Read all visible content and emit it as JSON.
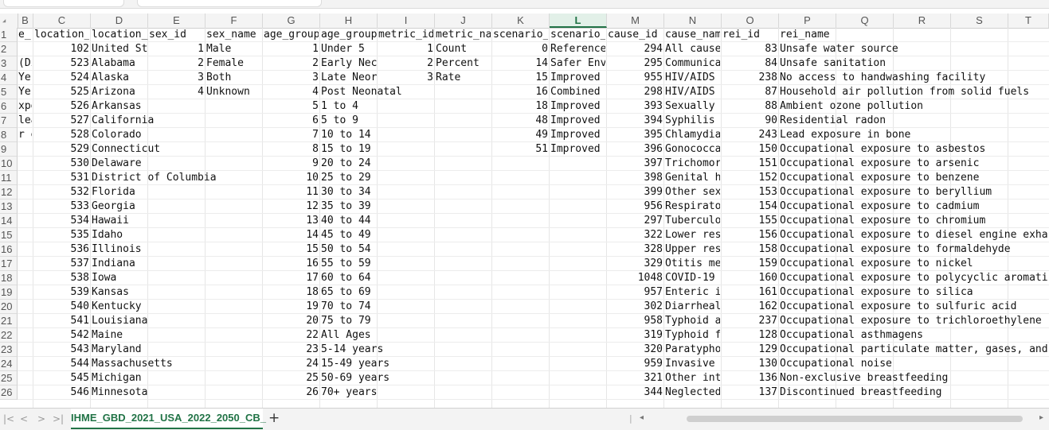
{
  "columns": [
    "B",
    "C",
    "D",
    "E",
    "F",
    "G",
    "H",
    "I",
    "J",
    "K",
    "L",
    "M",
    "N",
    "O",
    "P",
    "Q",
    "R",
    "S",
    "T"
  ],
  "selected_column": "L",
  "rows": [
    {
      "n": "1",
      "B": "e_r",
      "C": "location_",
      "D": "location_",
      "E": "sex_id",
      "F": "sex_name",
      "G": "age_group",
      "H": "age_group",
      "I": "metric_id",
      "J": "metric_na",
      "K": "scenario_",
      "L": "scenario_",
      "M": "cause_id",
      "N": "cause_nam",
      "O": "rei_id",
      "P": "rei_name"
    },
    {
      "n": "2",
      "B": "",
      "C": "102",
      "D": "United St",
      "E": "1",
      "F": "Male",
      "G": "1",
      "H": "Under 5",
      "I": "1",
      "J": "Count",
      "K": "0",
      "L": "Reference",
      "M": "294",
      "N": "All cause",
      "O": "83",
      "P": "Unsafe water source"
    },
    {
      "n": "3",
      "B": "(Di",
      "C": "523",
      "D": "Alabama",
      "E": "2",
      "F": "Female",
      "G": "2",
      "H": "Early Nec",
      "I": "2",
      "J": "Percent",
      "K": "14",
      "L": "Safer Env",
      "M": "295",
      "N": "Communica",
      "O": "84",
      "P": "Unsafe sanitation"
    },
    {
      "n": "4",
      "B": "Yes",
      "C": "524",
      "D": "Alaska",
      "E": "3",
      "F": "Both",
      "G": "3",
      "H": "Late Neor",
      "I": "3",
      "J": "Rate",
      "K": "15",
      "L": "Improved",
      "M": "955",
      "N": "HIV/AIDS",
      "O": "238",
      "P": "No access to handwashing facility"
    },
    {
      "n": "5",
      "B": "Yes",
      "C": "525",
      "D": "Arizona",
      "E": "4",
      "F": "Unknown",
      "G": "4",
      "H": "Post Neonatal",
      "I": "",
      "J": "",
      "K": "16",
      "L": "Combined",
      "M": "298",
      "N": "HIV/AIDS",
      "O": "87",
      "P": "Household air pollution from solid fuels"
    },
    {
      "n": "6",
      "B": "xpe",
      "C": "526",
      "D": "Arkansas",
      "E": "",
      "F": "",
      "G": "5",
      "H": "1 to 4",
      "I": "",
      "J": "",
      "K": "18",
      "L": "Improved",
      "M": "393",
      "N": "Sexually",
      "O": "88",
      "P": "Ambient ozone pollution"
    },
    {
      "n": "7",
      "B": "lea",
      "C": "527",
      "D": "California",
      "E": "",
      "F": "",
      "G": "6",
      "H": "5 to 9",
      "I": "",
      "J": "",
      "K": "48",
      "L": "Improved",
      "M": "394",
      "N": "Syphilis",
      "O": "90",
      "P": "Residential radon"
    },
    {
      "n": "8",
      "B": "r e",
      "C": "528",
      "D": "Colorado",
      "E": "",
      "F": "",
      "G": "7",
      "H": "10 to 14",
      "I": "",
      "J": "",
      "K": "49",
      "L": "Improved",
      "M": "395",
      "N": "Chlamydia",
      "O": "243",
      "P": "Lead exposure in bone"
    },
    {
      "n": "9",
      "B": "",
      "C": "529",
      "D": "Connecticut",
      "E": "",
      "F": "",
      "G": "8",
      "H": "15 to 19",
      "I": "",
      "J": "",
      "K": "51",
      "L": "Improved",
      "M": "396",
      "N": "Gonococca",
      "O": "150",
      "P": "Occupational exposure to asbestos"
    },
    {
      "n": "10",
      "B": "",
      "C": "530",
      "D": "Delaware",
      "E": "",
      "F": "",
      "G": "9",
      "H": "20 to 24",
      "I": "",
      "J": "",
      "K": "",
      "L": "",
      "M": "397",
      "N": "Trichomor",
      "O": "151",
      "P": "Occupational exposure to arsenic"
    },
    {
      "n": "11",
      "B": "",
      "C": "531",
      "D": "District of Columbia",
      "E": "",
      "F": "",
      "G": "10",
      "H": "25 to 29",
      "I": "",
      "J": "",
      "K": "",
      "L": "",
      "M": "398",
      "N": "Genital h",
      "O": "152",
      "P": "Occupational exposure to benzene"
    },
    {
      "n": "12",
      "B": "",
      "C": "532",
      "D": "Florida",
      "E": "",
      "F": "",
      "G": "11",
      "H": "30 to 34",
      "I": "",
      "J": "",
      "K": "",
      "L": "",
      "M": "399",
      "N": "Other sex",
      "O": "153",
      "P": "Occupational exposure to beryllium"
    },
    {
      "n": "13",
      "B": "",
      "C": "533",
      "D": "Georgia",
      "E": "",
      "F": "",
      "G": "12",
      "H": "35 to 39",
      "I": "",
      "J": "",
      "K": "",
      "L": "",
      "M": "956",
      "N": "Respirato",
      "O": "154",
      "P": "Occupational exposure to cadmium"
    },
    {
      "n": "14",
      "B": "",
      "C": "534",
      "D": "Hawaii",
      "E": "",
      "F": "",
      "G": "13",
      "H": "40 to 44",
      "I": "",
      "J": "",
      "K": "",
      "L": "",
      "M": "297",
      "N": "Tuberculo",
      "O": "155",
      "P": "Occupational exposure to chromium"
    },
    {
      "n": "15",
      "B": "",
      "C": "535",
      "D": "Idaho",
      "E": "",
      "F": "",
      "G": "14",
      "H": "45 to 49",
      "I": "",
      "J": "",
      "K": "",
      "L": "",
      "M": "322",
      "N": "Lower res",
      "O": "156",
      "P": "Occupational exposure to diesel engine exha"
    },
    {
      "n": "16",
      "B": "",
      "C": "536",
      "D": "Illinois",
      "E": "",
      "F": "",
      "G": "15",
      "H": "50 to 54",
      "I": "",
      "J": "",
      "K": "",
      "L": "",
      "M": "328",
      "N": "Upper res",
      "O": "158",
      "P": "Occupational exposure to formaldehyde"
    },
    {
      "n": "17",
      "B": "",
      "C": "537",
      "D": "Indiana",
      "E": "",
      "F": "",
      "G": "16",
      "H": "55 to 59",
      "I": "",
      "J": "",
      "K": "",
      "L": "",
      "M": "329",
      "N": "Otitis me",
      "O": "159",
      "P": "Occupational exposure to nickel"
    },
    {
      "n": "18",
      "B": "",
      "C": "538",
      "D": "Iowa",
      "E": "",
      "F": "",
      "G": "17",
      "H": "60 to 64",
      "I": "",
      "J": "",
      "K": "",
      "L": "",
      "M": "1048",
      "N": "COVID-19",
      "O": "160",
      "P": "Occupational exposure to polycyclic aromati"
    },
    {
      "n": "19",
      "B": "",
      "C": "539",
      "D": "Kansas",
      "E": "",
      "F": "",
      "G": "18",
      "H": "65 to 69",
      "I": "",
      "J": "",
      "K": "",
      "L": "",
      "M": "957",
      "N": "Enteric i",
      "O": "161",
      "P": "Occupational exposure to silica"
    },
    {
      "n": "20",
      "B": "",
      "C": "540",
      "D": "Kentucky",
      "E": "",
      "F": "",
      "G": "19",
      "H": "70 to 74",
      "I": "",
      "J": "",
      "K": "",
      "L": "",
      "M": "302",
      "N": "Diarrheal",
      "O": "162",
      "P": "Occupational exposure to sulfuric acid"
    },
    {
      "n": "21",
      "B": "",
      "C": "541",
      "D": "Louisiana",
      "E": "",
      "F": "",
      "G": "20",
      "H": "75 to 79",
      "I": "",
      "J": "",
      "K": "",
      "L": "",
      "M": "958",
      "N": "Typhoid a",
      "O": "237",
      "P": "Occupational exposure to trichloroethylene"
    },
    {
      "n": "22",
      "B": "",
      "C": "542",
      "D": "Maine",
      "E": "",
      "F": "",
      "G": "22",
      "H": "All Ages",
      "I": "",
      "J": "",
      "K": "",
      "L": "",
      "M": "319",
      "N": "Typhoid f",
      "O": "128",
      "P": "Occupational asthmagens"
    },
    {
      "n": "23",
      "B": "",
      "C": "543",
      "D": "Maryland",
      "E": "",
      "F": "",
      "G": "23",
      "H": "5-14 years",
      "I": "",
      "J": "",
      "K": "",
      "L": "",
      "M": "320",
      "N": "Paratypho",
      "O": "129",
      "P": "Occupational particulate matter, gases, and"
    },
    {
      "n": "24",
      "B": "",
      "C": "544",
      "D": "Massachusetts",
      "E": "",
      "F": "",
      "G": "24",
      "H": "15-49 years",
      "I": "",
      "J": "",
      "K": "",
      "L": "",
      "M": "959",
      "N": "Invasive",
      "O": "130",
      "P": "Occupational noise"
    },
    {
      "n": "25",
      "B": "",
      "C": "545",
      "D": "Michigan",
      "E": "",
      "F": "",
      "G": "25",
      "H": "50-69 years",
      "I": "",
      "J": "",
      "K": "",
      "L": "",
      "M": "321",
      "N": "Other int",
      "O": "136",
      "P": "Non-exclusive breastfeeding"
    },
    {
      "n": "26",
      "B": "",
      "C": "546",
      "D": "Minnesota",
      "E": "",
      "F": "",
      "G": "26",
      "H": "70+ years",
      "I": "",
      "J": "",
      "K": "",
      "L": "",
      "M": "344",
      "N": "Neglected",
      "O": "137",
      "P": "Discontinued breastfeeding"
    }
  ],
  "sheet_tab": "IHME_GBD_2021_USA_2022_2050_CB_",
  "add_sheet": "+",
  "nav": {
    "first": "|<",
    "prev": "<",
    "next": ">",
    "last": ">|"
  }
}
